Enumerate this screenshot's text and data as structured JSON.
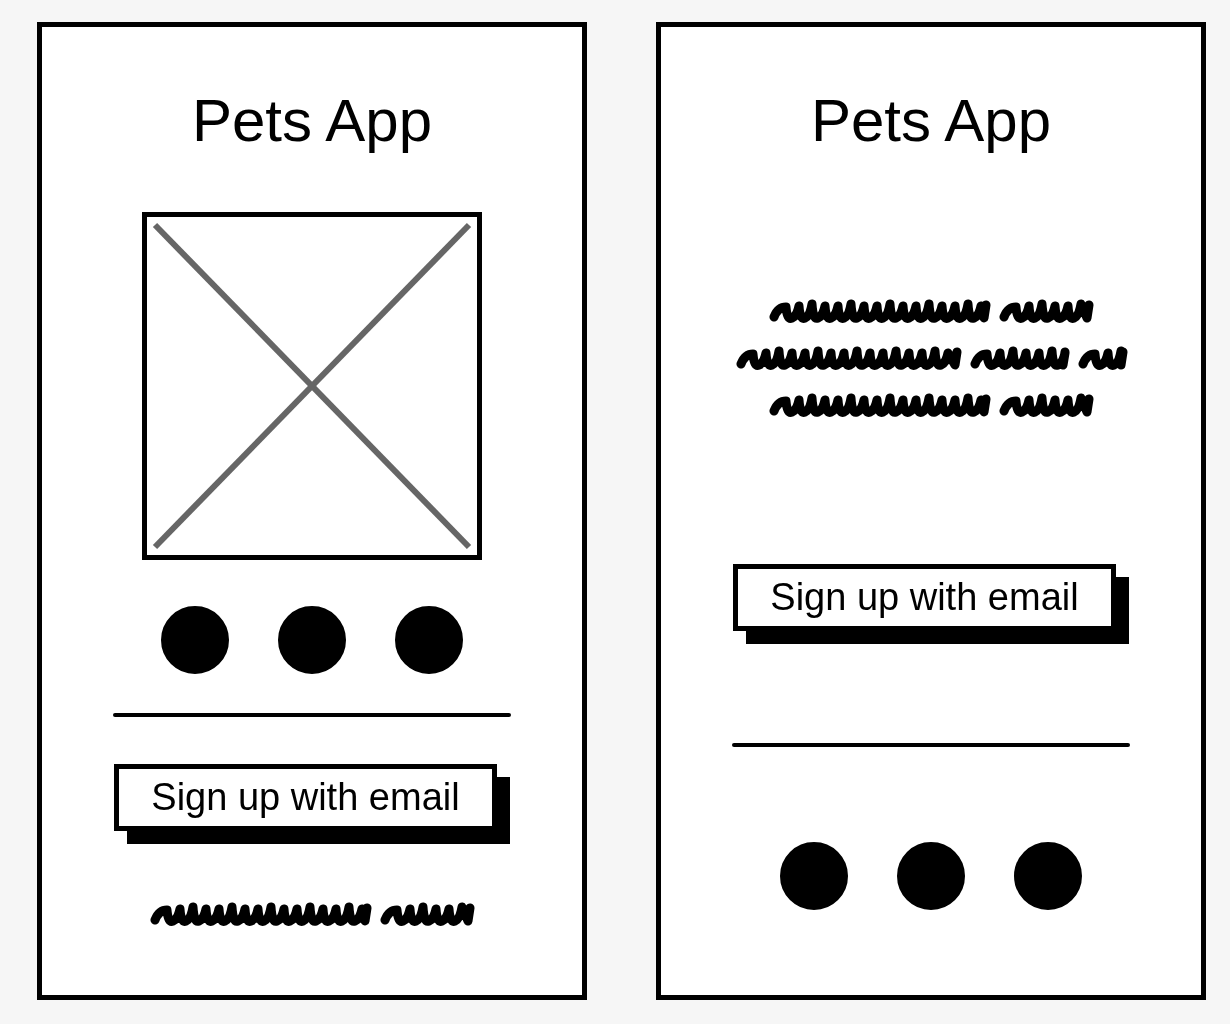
{
  "screens": [
    {
      "title": "Pets App",
      "parts": [
        {
          "kind": "image"
        },
        {
          "kind": "dots",
          "dots": [
            {
              "filled": true
            },
            {
              "filled": true
            },
            {
              "filled": true
            }
          ]
        },
        {
          "kind": "rule"
        },
        {
          "kind": "button",
          "label": "Sign up with email"
        },
        {
          "kind": "scribble",
          "lines": [
            {
              "kind": "two-word"
            }
          ]
        }
      ]
    },
    {
      "title": "Pets App",
      "parts": [
        {
          "kind": "scribble",
          "lines": [
            {
              "kind": "two-word"
            },
            {
              "kind": "three-word"
            },
            {
              "kind": "two-word"
            }
          ]
        },
        {
          "kind": "button",
          "label": "Sign up with email"
        },
        {
          "kind": "rule"
        },
        {
          "kind": "dots",
          "dots": [
            {
              "filled": true
            },
            {
              "filled": true
            },
            {
              "filled": true
            }
          ]
        }
      ]
    }
  ]
}
